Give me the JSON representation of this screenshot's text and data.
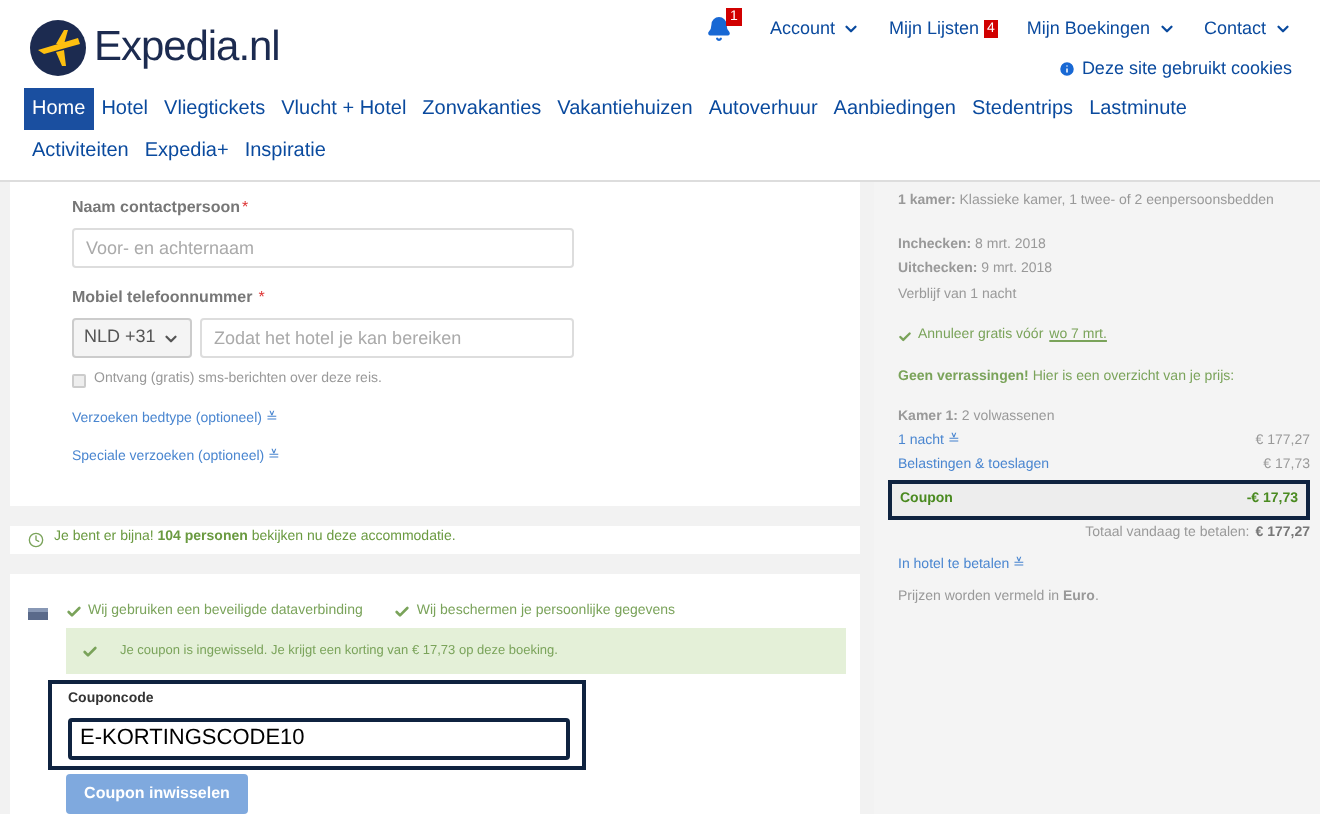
{
  "logo": {
    "text": "Expedia.nl"
  },
  "top_links": [
    {
      "kind": "bell",
      "badge": "1"
    },
    {
      "kind": "menu",
      "label": "Account"
    },
    {
      "kind": "badge",
      "label": "Mijn Lijsten",
      "badge": "4"
    },
    {
      "kind": "menu",
      "label": "Mijn Boekingen"
    },
    {
      "kind": "menu",
      "label": "Contact"
    }
  ],
  "cookie_notice": "Deze site gebruikt cookies",
  "nav": [
    {
      "label": "Home",
      "selected": true
    },
    {
      "label": "Hotel",
      "selected": false
    },
    {
      "label": "Vliegtickets",
      "selected": false
    },
    {
      "label": "Vlucht + Hotel",
      "selected": false
    },
    {
      "label": "Zonvakanties",
      "selected": false
    },
    {
      "label": "Vakantiehuizen",
      "selected": false
    },
    {
      "label": "Autoverhuur",
      "selected": false
    },
    {
      "label": "Aanbiedingen",
      "selected": false
    },
    {
      "label": "Stedentrips",
      "selected": false
    },
    {
      "label": "Lastminute",
      "selected": false
    },
    {
      "label": "Activiteiten",
      "selected": false
    },
    {
      "label": "Expedia+",
      "selected": false
    },
    {
      "label": "Inspiratie",
      "selected": false
    }
  ],
  "contact_form": {
    "required_mark": "*",
    "name_label": "Naam contactpersoon",
    "name_placeholder": "Voor- en achternaam",
    "phone_label": "Mobiel telefoonnummer",
    "country_code": "NLD +31",
    "phone_placeholder": "Zodat het hotel je kan bereiken",
    "sms": {
      "label": "Ontvang (gratis) sms-berichten over deze reis.",
      "checked": false
    },
    "links": [
      "Verzoeken bedtype (optioneel) ≚",
      "Speciale verzoeken (optioneel) ≚"
    ]
  },
  "notice": "Je bent er bijna! **104 personen** bekijken nu deze accommodatie.",
  "security": [
    "Wij gebruiken een beveiligde dataverbinding",
    "Wij beschermen je persoonlijke gegevens"
  ],
  "coupon_message": "Je coupon is ingewisseld. Je krijgt een korting van € 17,73 op deze boeking.",
  "coupon": {
    "label": "Couponcode",
    "value": "E-KORTINGSCODE10",
    "button": "Coupon inwisselen",
    "highlighted": true
  },
  "summary": {
    "room": "**1 kamer:** Klassieke kamer, 1 twee- of 2 eenpersoonsbedden",
    "checkin": "**Inchecken:** 8 mrt. 2018",
    "checkout": "**Uitchecken:** 9 mrt. 2018",
    "stay": "Verblijf van 1 nacht",
    "cancel_text": "Annuleer gratis vóór",
    "cancel_date": "wo 7 mrt.",
    "overview": "**Geen verrassingen!** Hier is een overzicht van je prijs:",
    "guests": "**Kamer 1:** 2 volwassenen",
    "lines": [
      {
        "kind": "link",
        "label": "1 nacht ≚",
        "amount": "€ 177,27",
        "highlighted": false
      },
      {
        "kind": "link",
        "label": "Belastingen & toeslagen",
        "amount": "€ 17,73",
        "highlighted": false
      },
      {
        "kind": "discount",
        "label": "Coupon",
        "amount": "-€ 17,73",
        "highlighted": true
      }
    ],
    "total_label": "Totaal vandaag te betalen:",
    "total": "€ 177,27",
    "pay_at_hotel": "In hotel te betalen ≚",
    "currency_note": "Prijzen worden vermeld in **Euro**."
  }
}
